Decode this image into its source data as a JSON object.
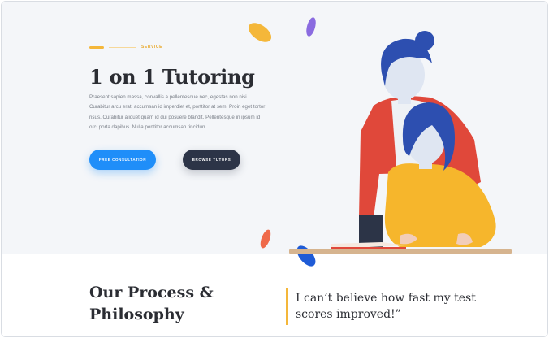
{
  "hero": {
    "eyebrow": "SERVICE",
    "title": "1 on 1 Tutoring",
    "description": "Praesent sapien massa, convallis a pellentesque nec, egestas non nisi. Curabitur arcu erat, accumsan id imperdiet et, porttitor at sem. Proin eget tortor risus. Curabitur aliquet quam id dui posuere blandit. Pellentesque in ipsum id orci porta dapibus. Nulla porttitor accumsan tincidun",
    "buttons": {
      "primary_label": "FREE CONSULTATION",
      "secondary_label": "BROWSE TUTORS"
    }
  },
  "process": {
    "title_line1": "Our Process &",
    "title_line2": "Philosophy"
  },
  "testimonial": {
    "quote": "I can’t believe how fast my test scores improved!”"
  },
  "colors": {
    "accent_yellow": "#f4b73a",
    "primary_blue": "#1f8ef9",
    "dark_navy": "#2c3447",
    "hero_bg": "#f4f6f9"
  },
  "icons": {
    "illustration": "tutor-and-student-illustration"
  }
}
